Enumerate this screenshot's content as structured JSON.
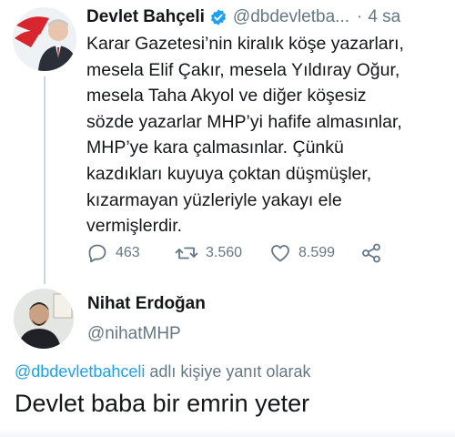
{
  "tweet": {
    "author_name": "Devlet Bahçeli",
    "author_handle": "@dbdevletba...",
    "separator": "·",
    "time": "4 sa",
    "lines": [
      "Karar Gazetesi’nin kiralık köşe yazarları,",
      "mesela Elif Çakır, mesela Yıldıray Oğur,",
      "mesela Taha Akyol ve diğer köşesiz",
      "sözde yazarlar MHP’yi hafife almasınlar,",
      "MHP’ye kara çalmasınlar. Çünkü",
      "kazdıkları kuyuya çoktan düşmüşler,",
      "kızarmayan yüzleriyle yakayı ele",
      "vermişlerdir."
    ],
    "reply_count": "463",
    "retweet_count": "3.560",
    "like_count": "8.599",
    "icons": {
      "reply": "reply-icon",
      "retweet": "retweet-icon",
      "like": "heart-icon",
      "share": "share-icon",
      "verified": "verified-badge-icon"
    }
  },
  "reply": {
    "author_name": "Nihat Erdoğan",
    "author_handle": "@nihatMHP",
    "reply_to_mention": "@dbdevletbahceli",
    "reply_to_suffix": " adlı kişiye yanıt olarak",
    "text": "Devlet baba bir emrin yeter"
  },
  "colors": {
    "text": "#14171a",
    "muted": "#657786",
    "link": "#1da1f2",
    "verified": "#1da1f2",
    "thread_line": "#ccd6dd"
  }
}
